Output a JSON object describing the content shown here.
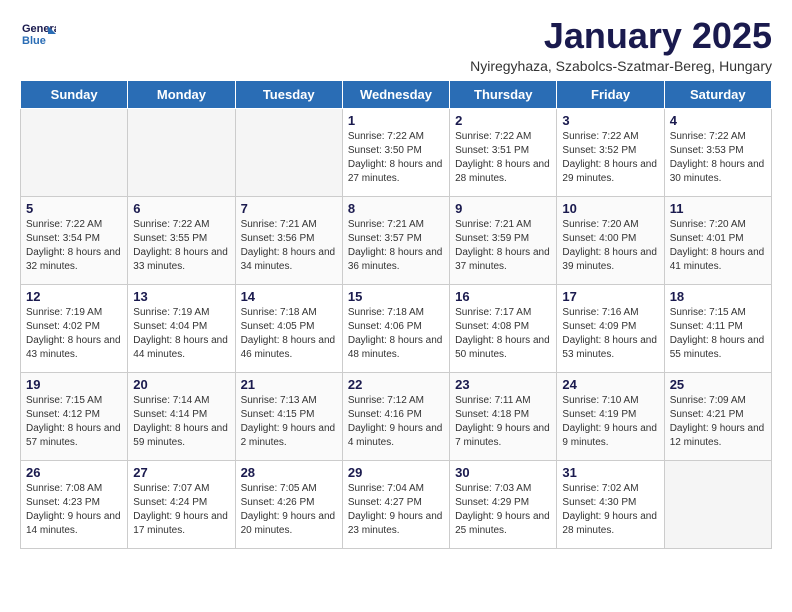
{
  "header": {
    "logo_line1": "General",
    "logo_line2": "Blue",
    "title": "January 2025",
    "subtitle": "Nyiregyhaza, Szabolcs-Szatmar-Bereg, Hungary"
  },
  "weekdays": [
    "Sunday",
    "Monday",
    "Tuesday",
    "Wednesday",
    "Thursday",
    "Friday",
    "Saturday"
  ],
  "weeks": [
    [
      {
        "day": "",
        "info": ""
      },
      {
        "day": "",
        "info": ""
      },
      {
        "day": "",
        "info": ""
      },
      {
        "day": "1",
        "info": "Sunrise: 7:22 AM\nSunset: 3:50 PM\nDaylight: 8 hours and 27 minutes."
      },
      {
        "day": "2",
        "info": "Sunrise: 7:22 AM\nSunset: 3:51 PM\nDaylight: 8 hours and 28 minutes."
      },
      {
        "day": "3",
        "info": "Sunrise: 7:22 AM\nSunset: 3:52 PM\nDaylight: 8 hours and 29 minutes."
      },
      {
        "day": "4",
        "info": "Sunrise: 7:22 AM\nSunset: 3:53 PM\nDaylight: 8 hours and 30 minutes."
      }
    ],
    [
      {
        "day": "5",
        "info": "Sunrise: 7:22 AM\nSunset: 3:54 PM\nDaylight: 8 hours and 32 minutes."
      },
      {
        "day": "6",
        "info": "Sunrise: 7:22 AM\nSunset: 3:55 PM\nDaylight: 8 hours and 33 minutes."
      },
      {
        "day": "7",
        "info": "Sunrise: 7:21 AM\nSunset: 3:56 PM\nDaylight: 8 hours and 34 minutes."
      },
      {
        "day": "8",
        "info": "Sunrise: 7:21 AM\nSunset: 3:57 PM\nDaylight: 8 hours and 36 minutes."
      },
      {
        "day": "9",
        "info": "Sunrise: 7:21 AM\nSunset: 3:59 PM\nDaylight: 8 hours and 37 minutes."
      },
      {
        "day": "10",
        "info": "Sunrise: 7:20 AM\nSunset: 4:00 PM\nDaylight: 8 hours and 39 minutes."
      },
      {
        "day": "11",
        "info": "Sunrise: 7:20 AM\nSunset: 4:01 PM\nDaylight: 8 hours and 41 minutes."
      }
    ],
    [
      {
        "day": "12",
        "info": "Sunrise: 7:19 AM\nSunset: 4:02 PM\nDaylight: 8 hours and 43 minutes."
      },
      {
        "day": "13",
        "info": "Sunrise: 7:19 AM\nSunset: 4:04 PM\nDaylight: 8 hours and 44 minutes."
      },
      {
        "day": "14",
        "info": "Sunrise: 7:18 AM\nSunset: 4:05 PM\nDaylight: 8 hours and 46 minutes."
      },
      {
        "day": "15",
        "info": "Sunrise: 7:18 AM\nSunset: 4:06 PM\nDaylight: 8 hours and 48 minutes."
      },
      {
        "day": "16",
        "info": "Sunrise: 7:17 AM\nSunset: 4:08 PM\nDaylight: 8 hours and 50 minutes."
      },
      {
        "day": "17",
        "info": "Sunrise: 7:16 AM\nSunset: 4:09 PM\nDaylight: 8 hours and 53 minutes."
      },
      {
        "day": "18",
        "info": "Sunrise: 7:15 AM\nSunset: 4:11 PM\nDaylight: 8 hours and 55 minutes."
      }
    ],
    [
      {
        "day": "19",
        "info": "Sunrise: 7:15 AM\nSunset: 4:12 PM\nDaylight: 8 hours and 57 minutes."
      },
      {
        "day": "20",
        "info": "Sunrise: 7:14 AM\nSunset: 4:14 PM\nDaylight: 8 hours and 59 minutes."
      },
      {
        "day": "21",
        "info": "Sunrise: 7:13 AM\nSunset: 4:15 PM\nDaylight: 9 hours and 2 minutes."
      },
      {
        "day": "22",
        "info": "Sunrise: 7:12 AM\nSunset: 4:16 PM\nDaylight: 9 hours and 4 minutes."
      },
      {
        "day": "23",
        "info": "Sunrise: 7:11 AM\nSunset: 4:18 PM\nDaylight: 9 hours and 7 minutes."
      },
      {
        "day": "24",
        "info": "Sunrise: 7:10 AM\nSunset: 4:19 PM\nDaylight: 9 hours and 9 minutes."
      },
      {
        "day": "25",
        "info": "Sunrise: 7:09 AM\nSunset: 4:21 PM\nDaylight: 9 hours and 12 minutes."
      }
    ],
    [
      {
        "day": "26",
        "info": "Sunrise: 7:08 AM\nSunset: 4:23 PM\nDaylight: 9 hours and 14 minutes."
      },
      {
        "day": "27",
        "info": "Sunrise: 7:07 AM\nSunset: 4:24 PM\nDaylight: 9 hours and 17 minutes."
      },
      {
        "day": "28",
        "info": "Sunrise: 7:05 AM\nSunset: 4:26 PM\nDaylight: 9 hours and 20 minutes."
      },
      {
        "day": "29",
        "info": "Sunrise: 7:04 AM\nSunset: 4:27 PM\nDaylight: 9 hours and 23 minutes."
      },
      {
        "day": "30",
        "info": "Sunrise: 7:03 AM\nSunset: 4:29 PM\nDaylight: 9 hours and 25 minutes."
      },
      {
        "day": "31",
        "info": "Sunrise: 7:02 AM\nSunset: 4:30 PM\nDaylight: 9 hours and 28 minutes."
      },
      {
        "day": "",
        "info": ""
      }
    ]
  ]
}
